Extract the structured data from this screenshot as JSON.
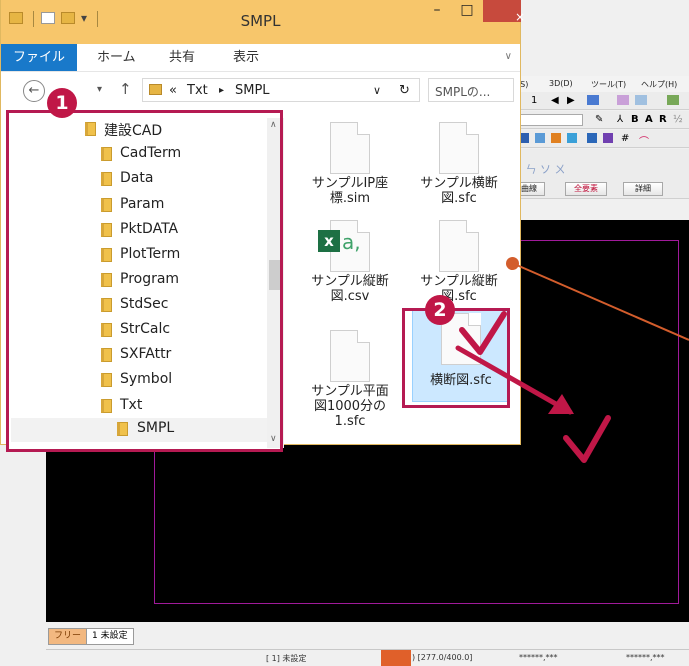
{
  "cad": {
    "menu": [
      "定(S)",
      "3D(D)",
      "ツール(T)",
      "ヘルプ(H)"
    ],
    "toolbar_row1": [
      "1",
      "◀",
      "▶"
    ],
    "toolbar_row2_glyphs": [
      "⅄",
      "B",
      "A",
      "R",
      "½"
    ],
    "toolbar_row4": {
      "curve_label": "曲線",
      "all_elements": "全要素",
      "detail": "詳細"
    },
    "tabs": {
      "free": "フリー",
      "unset": "1 未設定"
    },
    "status": {
      "layer": "[ 1] 未設定",
      "coords": ") [277.0/400.0]",
      "val1": "******,***",
      "val2": "******,***"
    },
    "colors": {
      "frame": "#a01a9a",
      "canvas": "#000000",
      "accent": "#c01747"
    }
  },
  "explorer": {
    "title": "SMPL",
    "window_buttons": [
      "–",
      "□",
      "×"
    ],
    "ribbon_tabs": [
      "ファイル",
      "ホーム",
      "共有",
      "表示"
    ],
    "address": {
      "prefix": "«",
      "crumbs": [
        "Txt",
        "SMPL"
      ],
      "search_placeholder": "SMPLの..."
    },
    "nav": {
      "back": "←",
      "forward": "→",
      "up": "↑",
      "refresh": "↻",
      "dropdown": "∨"
    },
    "tree": [
      "建設CAD",
      "CadTerm",
      "Data",
      "Param",
      "PktDATA",
      "PlotTerm",
      "Program",
      "StdSec",
      "StrCalc",
      "SXFAttr",
      "Symbol",
      "Txt",
      "SMPL"
    ],
    "files": [
      {
        "name": "サンプルIP座\n標.sim",
        "type": "doc"
      },
      {
        "name": "サンプル横断\n図.sfc",
        "type": "doc"
      },
      {
        "name": "サンプル縦断\n図.csv",
        "type": "excel"
      },
      {
        "name": "サンプル縦断\n図.sfc",
        "type": "doc"
      },
      {
        "name": "サンプル平面\n図1000分の\n1.sfc",
        "type": "doc"
      },
      {
        "name": "横断図.sfc",
        "type": "doc"
      }
    ]
  },
  "annotations": {
    "step1": "1",
    "step2": "2"
  }
}
